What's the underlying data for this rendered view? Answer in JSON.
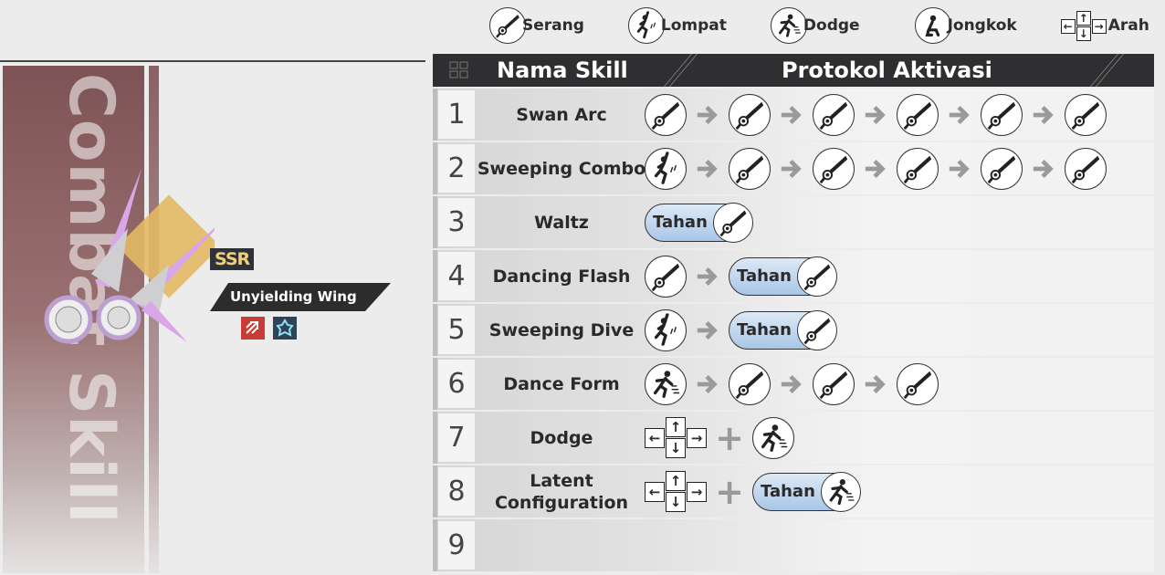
{
  "legend": [
    {
      "icon": "attack",
      "label": "Serang"
    },
    {
      "icon": "jump",
      "label": "Lompat"
    },
    {
      "icon": "dodge",
      "label": "Dodge"
    },
    {
      "icon": "crouch",
      "label": "Jongkok"
    },
    {
      "icon": "direction",
      "label": "Arah"
    }
  ],
  "side": {
    "title": "Combat Skill",
    "rarity": "SSR",
    "weapon_name": "Unyielding Wing",
    "elements": [
      "physical-icon",
      "ice-icon"
    ]
  },
  "table": {
    "col_name": "Nama Skill",
    "col_protocol": "Protokol Aktivasi",
    "hold_label": "Tahan",
    "rows": [
      {
        "num": "1",
        "name": "Swan Arc",
        "steps": [
          "attack",
          "arrow",
          "attack",
          "arrow",
          "attack",
          "arrow",
          "attack",
          "arrow",
          "attack",
          "arrow",
          "attack"
        ]
      },
      {
        "num": "2",
        "name": "Sweeping Combo",
        "steps": [
          "jump",
          "arrow",
          "attack",
          "arrow",
          "attack",
          "arrow",
          "attack",
          "arrow",
          "attack",
          "arrow",
          "attack"
        ]
      },
      {
        "num": "3",
        "name": "Waltz",
        "steps": [
          "hold-attack"
        ]
      },
      {
        "num": "4",
        "name": "Dancing Flash",
        "steps": [
          "attack",
          "arrow",
          "hold-attack"
        ]
      },
      {
        "num": "5",
        "name": "Sweeping Dive",
        "steps": [
          "jump",
          "arrow",
          "hold-attack"
        ]
      },
      {
        "num": "6",
        "name": "Dance Form",
        "steps": [
          "dodge",
          "arrow",
          "attack",
          "arrow",
          "attack",
          "arrow",
          "attack"
        ]
      },
      {
        "num": "7",
        "name": "Dodge",
        "steps": [
          "direction",
          "plus",
          "dodge"
        ]
      },
      {
        "num": "8",
        "name": "Latent Configuration",
        "steps": [
          "direction",
          "plus",
          "hold-dodge"
        ]
      },
      {
        "num": "9",
        "name": "",
        "steps": []
      }
    ]
  },
  "colors": {
    "accent_band": "#8b6062",
    "header": "#2f2f31",
    "hold_pill": "#a9c6e6"
  }
}
